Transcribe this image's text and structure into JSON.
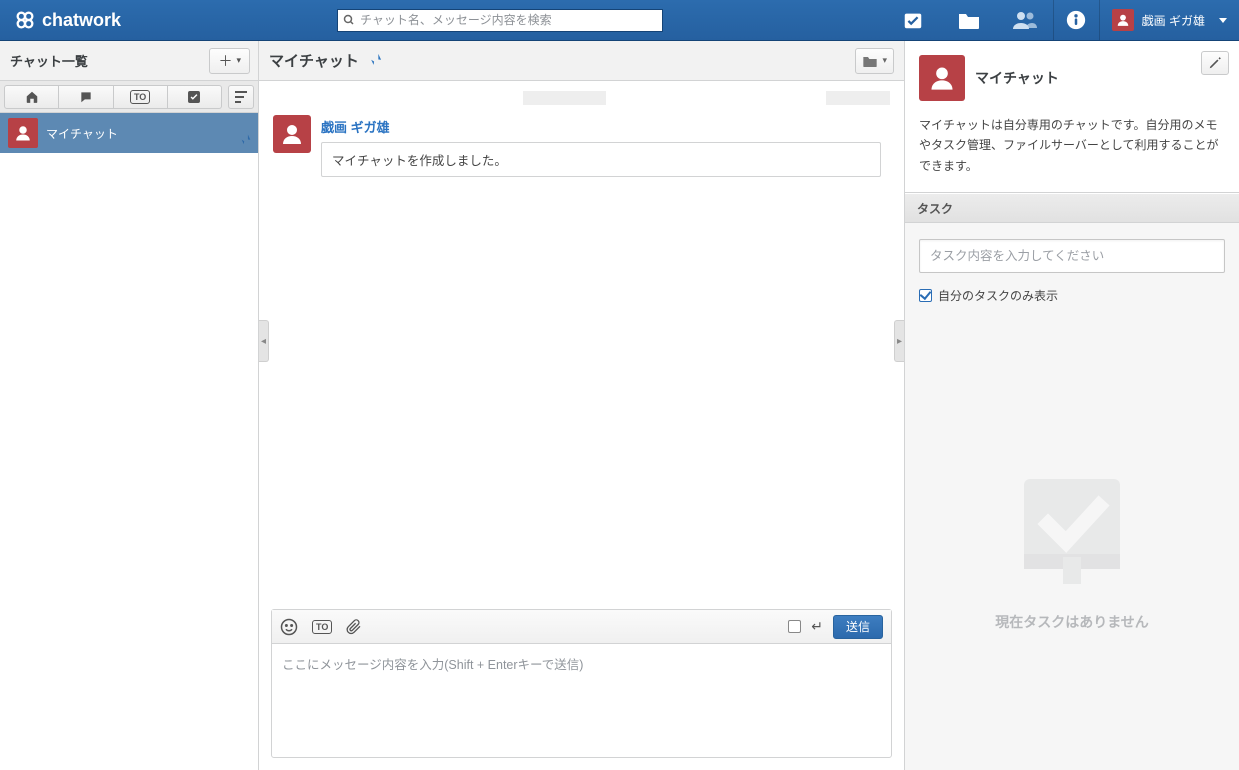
{
  "header": {
    "brand": "chatwork",
    "search_placeholder": "チャット名、メッセージ内容を検索",
    "user_name": "戯画 ギガ雄"
  },
  "sidebar": {
    "title": "チャット一覧",
    "chat": {
      "name": "マイチャット"
    }
  },
  "main": {
    "title": "マイチャット",
    "message": {
      "author": "戯画 ギガ雄",
      "text": "マイチャットを作成しました。"
    },
    "composer": {
      "placeholder": "ここにメッセージ内容を入力(Shift + Enterキーで送信)",
      "send_label": "送信"
    }
  },
  "right": {
    "title": "マイチャット",
    "description": "マイチャットは自分専用のチャットです。自分用のメモやタスク管理、ファイルサーバーとして利用することができます。",
    "task_header": "タスク",
    "task_placeholder": "タスク内容を入力してください",
    "task_checkbox_label": "自分のタスクのみ表示",
    "task_empty": "現在タスクはありません"
  },
  "icons": {
    "to": "TO"
  }
}
